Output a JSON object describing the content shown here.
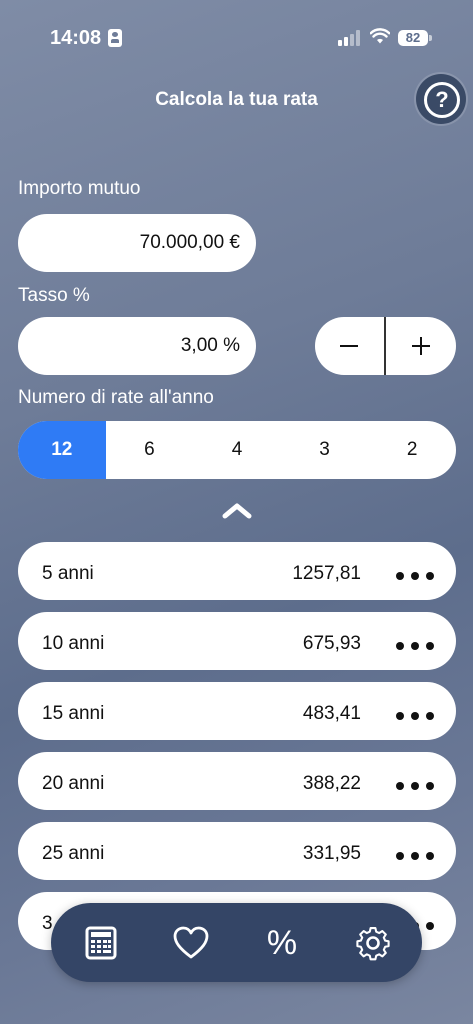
{
  "status": {
    "time": "14:08",
    "battery": "82"
  },
  "header": {
    "title": "Calcola la tua rata",
    "help_label": "?"
  },
  "loan": {
    "label": "Importo mutuo",
    "value": "70.000,00 €"
  },
  "rate": {
    "label": "Tasso %",
    "value": "3,00 %"
  },
  "installments": {
    "label": "Numero di rate all'anno",
    "options": [
      "12",
      "6",
      "4",
      "3",
      "2"
    ],
    "selected": "12"
  },
  "results": [
    {
      "years": "5 anni",
      "amount": "1257,81"
    },
    {
      "years": "10 anni",
      "amount": "675,93"
    },
    {
      "years": "15 anni",
      "amount": "483,41"
    },
    {
      "years": "20 anni",
      "amount": "388,22"
    },
    {
      "years": "25 anni",
      "amount": "331,95"
    },
    {
      "years": "3",
      "amount": ""
    }
  ],
  "tabbar": {
    "tabs": [
      "calculator-icon",
      "heart-icon",
      "percent-icon",
      "gear-icon"
    ],
    "percent_glyph": "%"
  },
  "colors": {
    "accent": "#2f7bf5",
    "tabbar": "#344566",
    "background": "#6e7c98"
  }
}
